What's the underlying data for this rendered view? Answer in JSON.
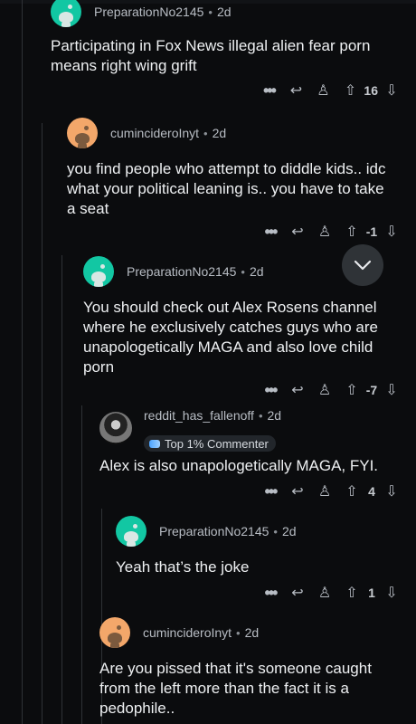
{
  "comments": [
    {
      "username": "PreparationNo2145",
      "age": "2d",
      "text": "Participating in Fox News illegal alien fear porn means right wing grift",
      "score": "16"
    },
    {
      "username": "cumincideroInyt",
      "age": "2d",
      "text": "you find people who attempt to diddle kids.. idc what your political leaning  is.. you have to take a seat",
      "score": "-1"
    },
    {
      "username": "PreparationNo2145",
      "age": "2d",
      "text": "You should check out Alex Rosens channel where he exclusively catches guys who are unapologetically MAGA and also love child porn",
      "score": "-7"
    },
    {
      "username": "reddit_has_fallenoff",
      "age": "2d",
      "flair": "Top 1% Commenter",
      "text": "Alex is also unapologetically MAGA, FYI.",
      "score": "4"
    },
    {
      "username": "PreparationNo2145",
      "age": "2d",
      "text": "Yeah that’s the joke",
      "score": "1"
    },
    {
      "username": "cumincideroInyt",
      "age": "2d",
      "text": "Are you pissed that it's someone caught from the left more than the fact it is a pedophile..",
      "score": ""
    }
  ],
  "ui": {
    "separator": "•",
    "more_glyph": "•••",
    "reply_glyph": "↩",
    "award_glyph": "♙",
    "upvote_glyph": "⇧",
    "downvote_glyph": "⇩",
    "fab_glyph": "⌄",
    "accent_teal": "#12c7a3",
    "accent_orange": "#f3a76a"
  }
}
